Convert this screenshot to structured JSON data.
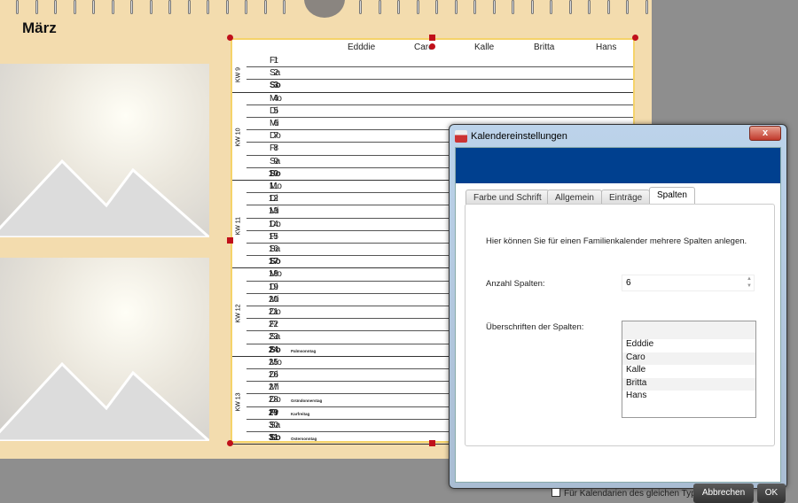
{
  "calendar": {
    "month": "März",
    "columns": [
      "Edddie",
      "Caro",
      "Kalle",
      "Britta",
      "Hans"
    ],
    "weeks": [
      {
        "label": "KW 9",
        "first": 1,
        "last": 3
      },
      {
        "label": "KW 10",
        "first": 4,
        "last": 10
      },
      {
        "label": "KW 11",
        "first": 11,
        "last": 17
      },
      {
        "label": "KW 12",
        "first": 18,
        "last": 24
      },
      {
        "label": "KW 13",
        "first": 25,
        "last": 31
      }
    ],
    "days": [
      {
        "n": "1",
        "d": "Fr"
      },
      {
        "n": "2",
        "d": "Sa"
      },
      {
        "n": "3",
        "d": "So",
        "bold": true
      },
      {
        "n": "4",
        "d": "Mo"
      },
      {
        "n": "5",
        "d": "Di"
      },
      {
        "n": "6",
        "d": "Mi"
      },
      {
        "n": "7",
        "d": "Do"
      },
      {
        "n": "8",
        "d": "Fr"
      },
      {
        "n": "9",
        "d": "Sa"
      },
      {
        "n": "10",
        "d": "So",
        "bold": true
      },
      {
        "n": "11",
        "d": "Mo"
      },
      {
        "n": "12",
        "d": "Di"
      },
      {
        "n": "13",
        "d": "Mi"
      },
      {
        "n": "14",
        "d": "Do"
      },
      {
        "n": "15",
        "d": "Fr"
      },
      {
        "n": "16",
        "d": "Sa"
      },
      {
        "n": "17",
        "d": "So",
        "bold": true
      },
      {
        "n": "18",
        "d": "Mo"
      },
      {
        "n": "19",
        "d": "Di"
      },
      {
        "n": "20",
        "d": "Mi"
      },
      {
        "n": "21",
        "d": "Do"
      },
      {
        "n": "22",
        "d": "Fr"
      },
      {
        "n": "23",
        "d": "Sa"
      },
      {
        "n": "24",
        "d": "So",
        "bold": true,
        "holiday": "Palmsonntag"
      },
      {
        "n": "25",
        "d": "Mo"
      },
      {
        "n": "26",
        "d": "Di"
      },
      {
        "n": "27",
        "d": "Mi"
      },
      {
        "n": "28",
        "d": "Do",
        "holiday": "Gründonnerstag"
      },
      {
        "n": "29",
        "d": "Fr",
        "bold": true,
        "holiday": "Karfreitag"
      },
      {
        "n": "30",
        "d": "Sa"
      },
      {
        "n": "31",
        "d": "So",
        "bold": true,
        "holiday": "Ostersonntag"
      }
    ]
  },
  "dialog": {
    "title": "Kalendereinstellungen",
    "close": "x",
    "tabs": [
      "Farbe und Schrift",
      "Allgemein",
      "Einträge",
      "Spalten"
    ],
    "active_tab": "Spalten",
    "intro": "Hier können Sie für einen Familienkalender mehrere Spalten anlegen.",
    "count_label": "Anzahl Spalten:",
    "count_value": "6",
    "headings_label": "Überschriften der Spalten:",
    "headings": [
      "",
      "Edddie",
      "Caro",
      "Kalle",
      "Britta",
      "Hans"
    ],
    "same_type_label": "Für Kalendarien des gleichen Typs.",
    "cancel": "Abbrechen",
    "ok": "OK"
  },
  "colors": {
    "page": "#f3dcae",
    "accent_blue": "#00408f",
    "handle": "#c0101a",
    "table_border": "#f5d36a"
  }
}
